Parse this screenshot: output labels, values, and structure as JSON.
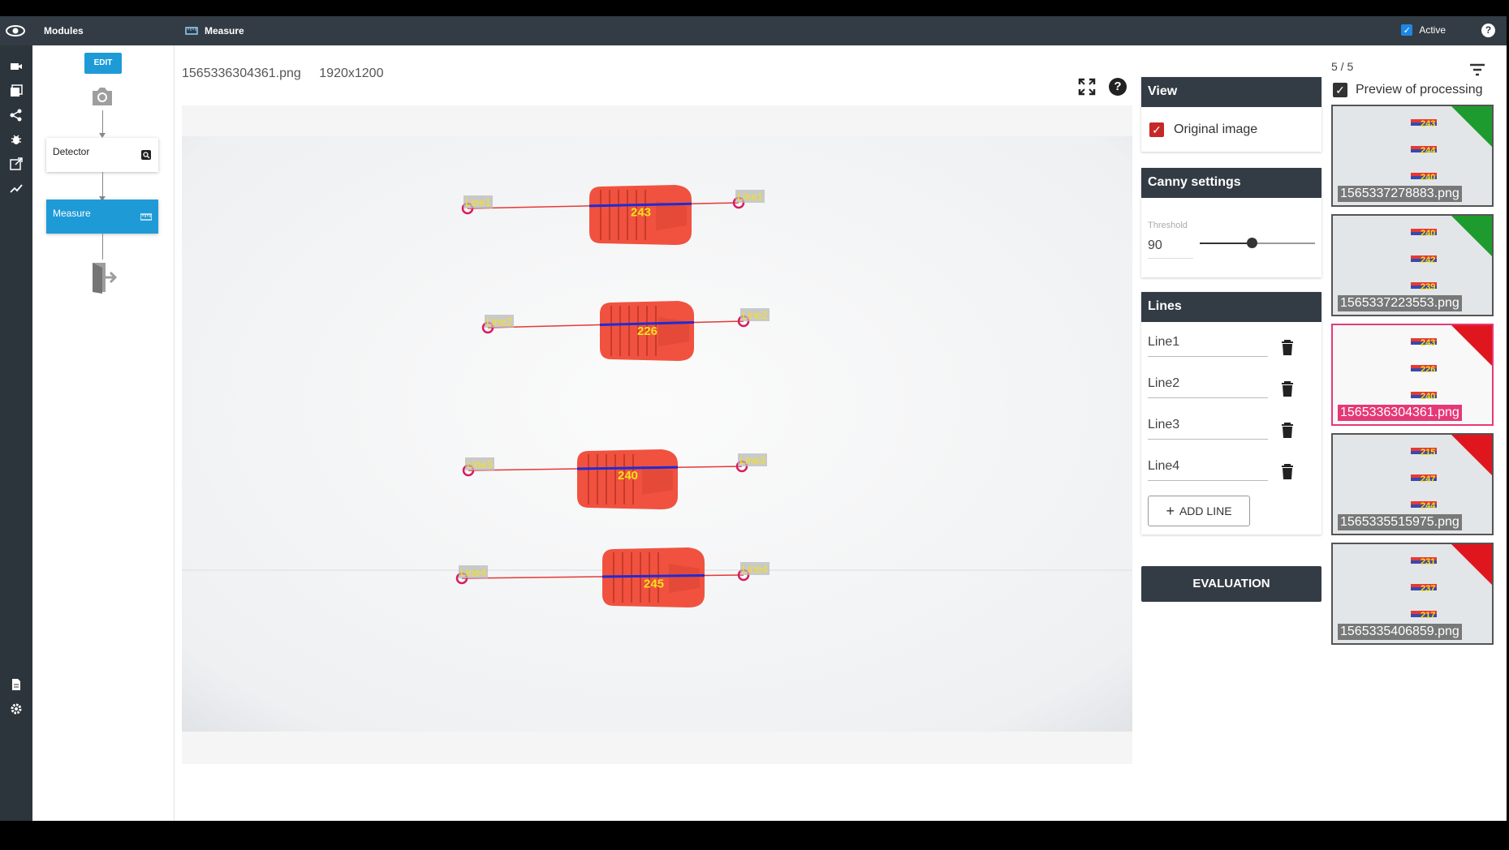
{
  "topbar": {
    "modules_label": "Modules",
    "module_title": "Measure",
    "active_label": "Active",
    "help_glyph": "?"
  },
  "pipeline": {
    "edit_label": "EDIT",
    "nodes": [
      {
        "label": "Detector",
        "icon": "search-icon"
      },
      {
        "label": "Measure",
        "icon": "ruler-icon"
      }
    ]
  },
  "image": {
    "filename": "1565336304361.png",
    "resolution": "1920x1200",
    "lines": [
      {
        "label": "Line1",
        "value": "243"
      },
      {
        "label": "Line2",
        "value": "226"
      },
      {
        "label": "Line3",
        "value": "240"
      },
      {
        "label": "Line4",
        "value": "245"
      }
    ]
  },
  "view_panel": {
    "title": "View",
    "original_image_label": "Original image",
    "original_image_checked": true
  },
  "canny_panel": {
    "title": "Canny settings",
    "threshold_label": "Threshold",
    "threshold_value": "90",
    "threshold_fraction": 0.45
  },
  "lines_panel": {
    "title": "Lines",
    "items": [
      "Line1",
      "Line2",
      "Line3",
      "Line4"
    ],
    "add_label": "ADD LINE"
  },
  "evaluation_label": "EVALUATION",
  "gallery": {
    "pager": "5 / 5",
    "preview_label": "Preview of processing",
    "thumbs": [
      {
        "name": "1565337278883.png",
        "values": [
          "243",
          "244",
          "240"
        ],
        "status": "ok"
      },
      {
        "name": "1565337223553.png",
        "values": [
          "240",
          "242",
          "239"
        ],
        "status": "ok"
      },
      {
        "name": "1565336304361.png",
        "values": [
          "243",
          "226",
          "240"
        ],
        "status": "fail",
        "selected": true
      },
      {
        "name": "1565335515975.png",
        "values": [
          "215",
          "247",
          "244"
        ],
        "status": "fail"
      },
      {
        "name": "1565335406859.png",
        "values": [
          "231",
          "237",
          "217"
        ],
        "status": "fail"
      }
    ]
  },
  "colors": {
    "accent": "#1e9bd7",
    "topbar": "#333c44",
    "ok": "#1e9b2e",
    "fail": "#e0161f",
    "selected": "#e53977"
  }
}
